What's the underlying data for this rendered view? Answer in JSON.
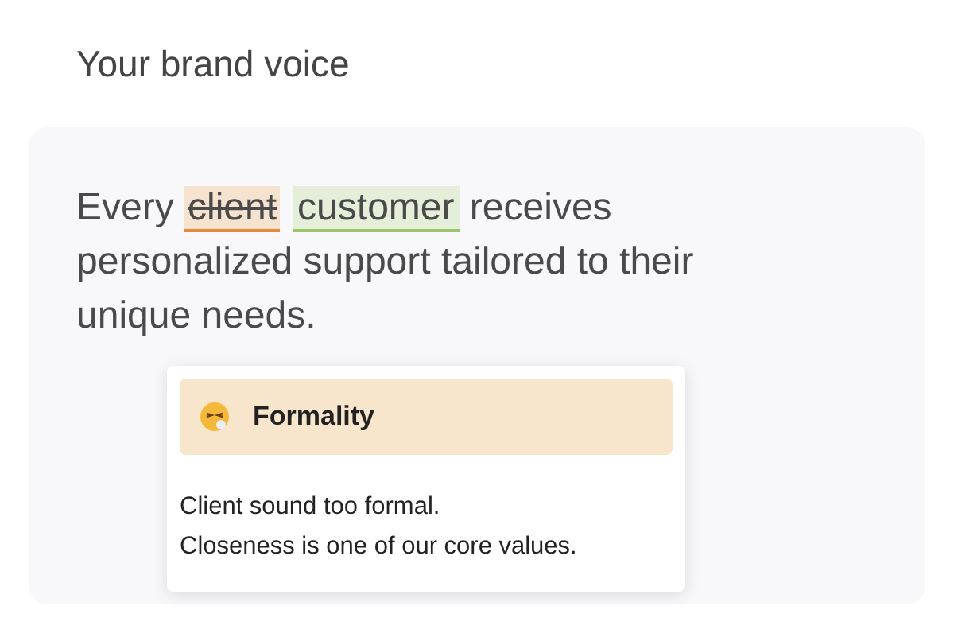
{
  "heading": "Your brand voice",
  "sentence": [
    {
      "kind": "plain",
      "text": "Every "
    },
    {
      "kind": "removed",
      "text": "client"
    },
    {
      "kind": "added",
      "text": "customer"
    },
    {
      "kind": "plain",
      "text": " receives personalized support tailored to their unique needs."
    }
  ],
  "tooltip": {
    "title": "Formality",
    "lines": [
      "Client sound too formal.",
      "Closeness is one of our core values."
    ]
  }
}
